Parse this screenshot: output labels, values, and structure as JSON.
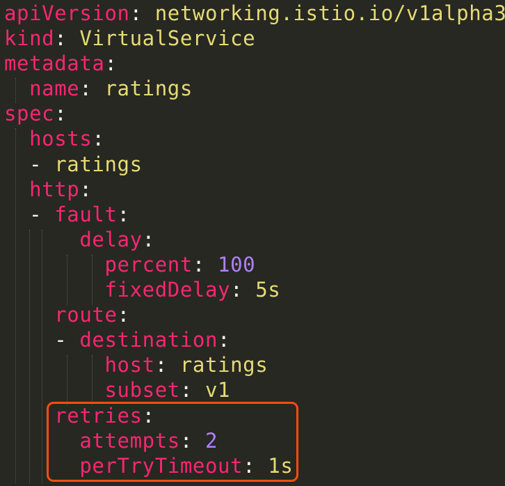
{
  "yaml": {
    "l1_key": "apiVersion",
    "l1_value": "networking.istio.io/v1alpha3",
    "l2_key": "kind",
    "l2_value": "VirtualService",
    "l3_key": "metadata",
    "l4_key": "name",
    "l4_value": "ratings",
    "l5_key": "spec",
    "l6_key": "hosts",
    "l7_dash": "-",
    "l7_value": "ratings",
    "l8_key": "http",
    "l9_dash": "-",
    "l9_key": "fault",
    "l10_key": "delay",
    "l11_key": "percent",
    "l11_value": "100",
    "l12_key": "fixedDelay",
    "l12_value": "5s",
    "l13_key": "route",
    "l14_dash": "-",
    "l14_key": "destination",
    "l15_key": "host",
    "l15_value": "ratings",
    "l16_key": "subset",
    "l16_value": "v1",
    "l17_key": "retries",
    "l18_key": "attempts",
    "l18_value": "2",
    "l19_key": "perTryTimeout",
    "l19_value": "1s"
  },
  "colors": {
    "background": "#272822",
    "key": "#f92672",
    "string": "#e6db74",
    "number": "#ae81ff",
    "highlight_box": "#ff4d12"
  }
}
